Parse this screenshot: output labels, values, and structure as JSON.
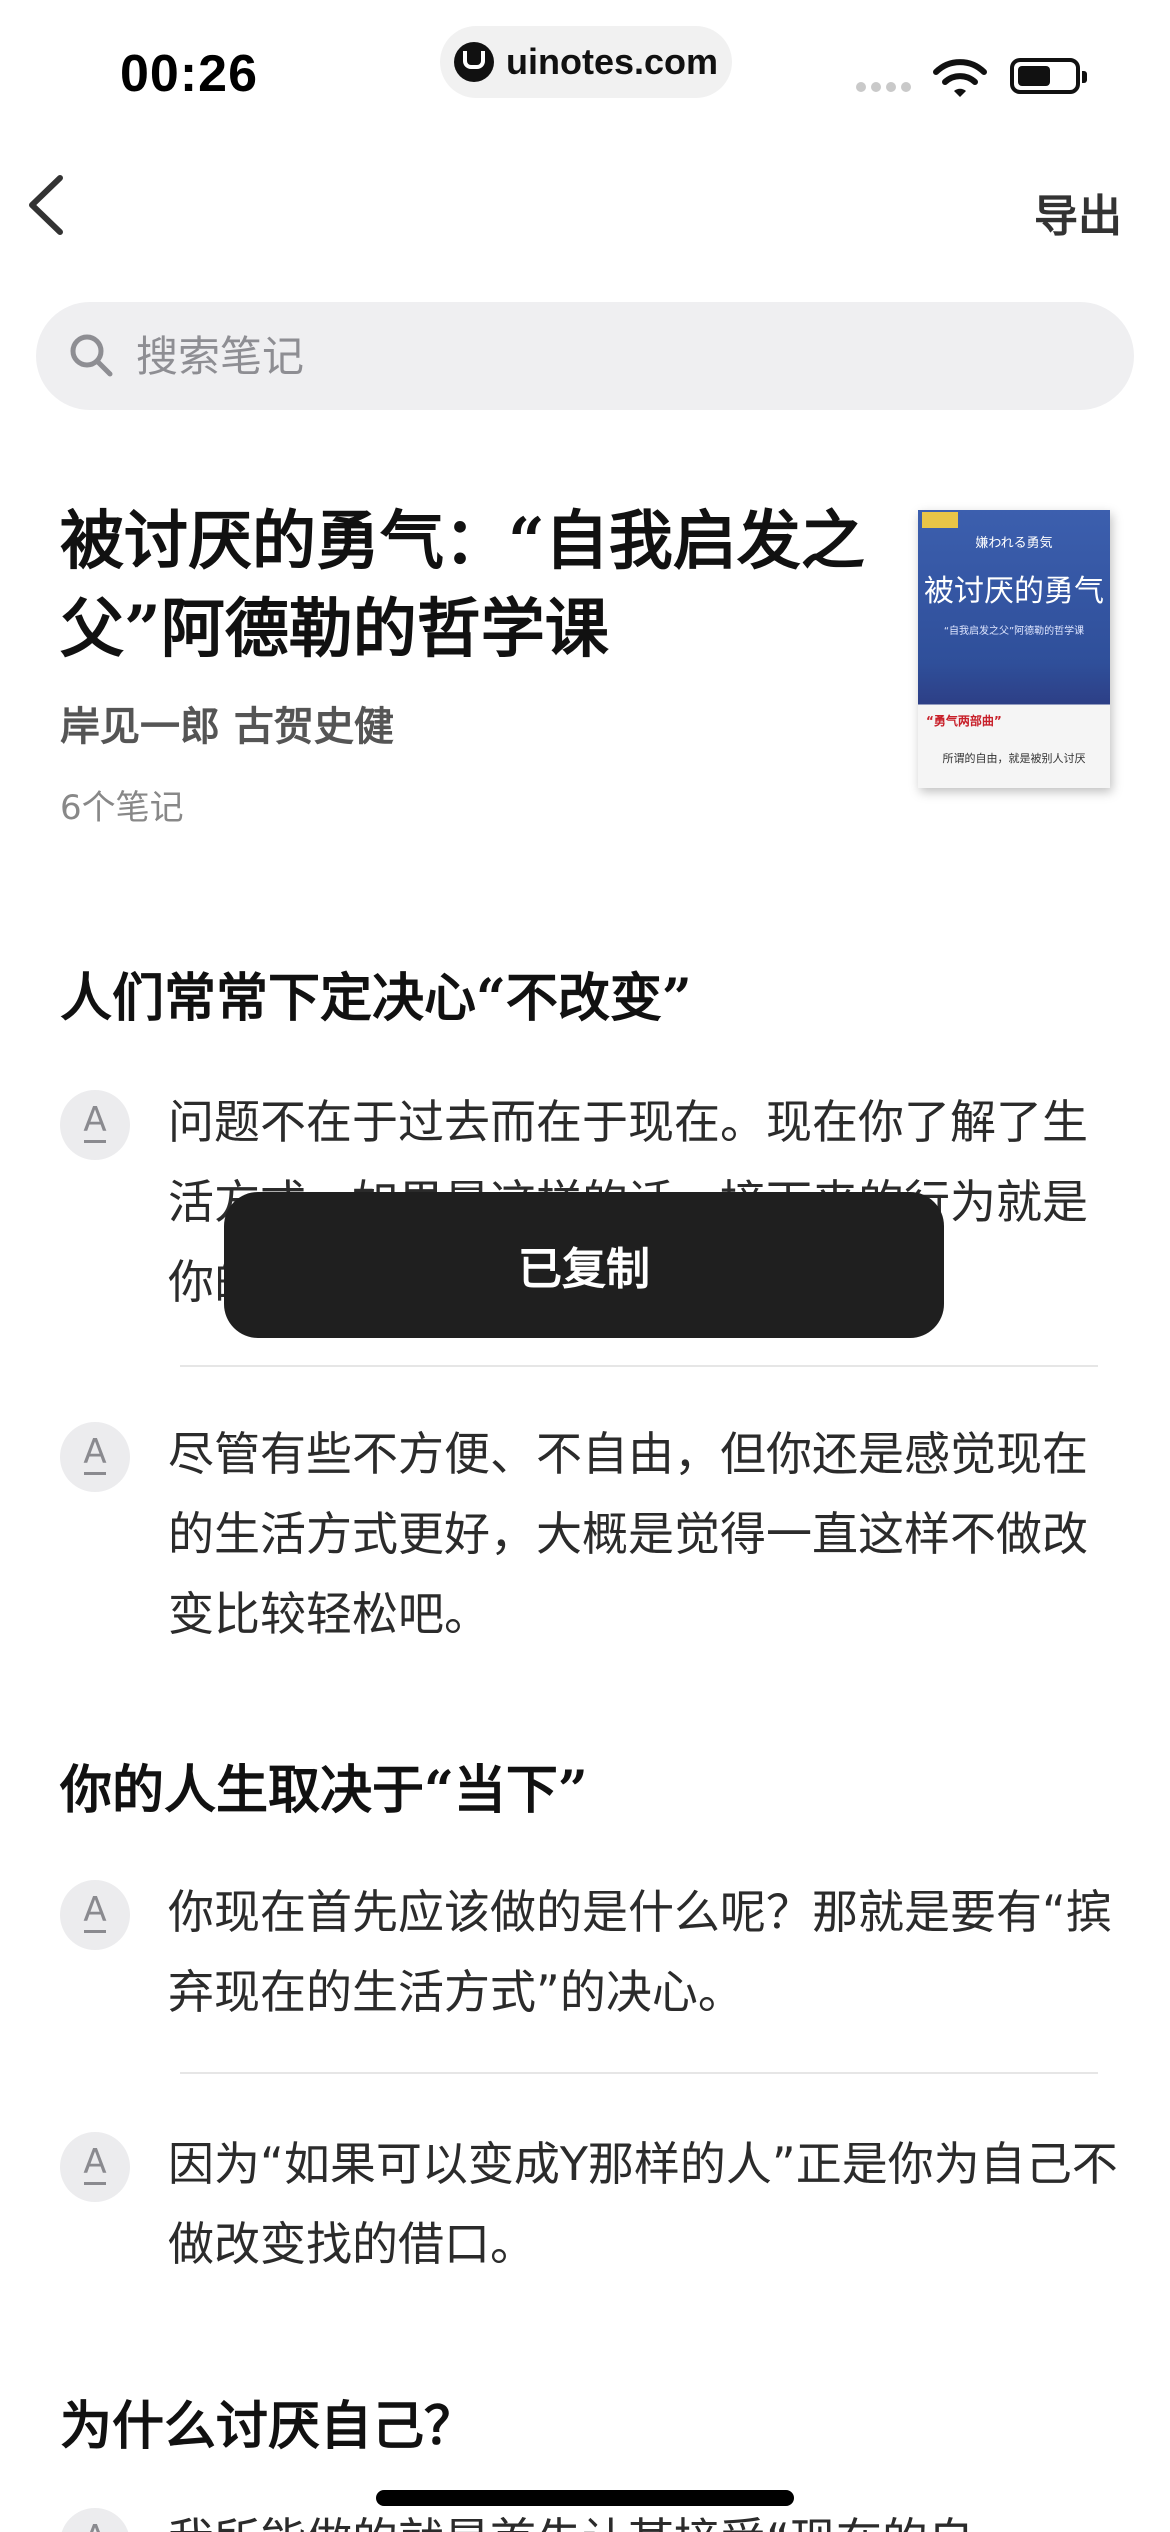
{
  "status_bar": {
    "time": "00:26",
    "url": "uinotes.com"
  },
  "nav": {
    "back_icon": "chevron-left-icon",
    "export_label": "导出"
  },
  "search": {
    "placeholder": "搜索笔记",
    "value": ""
  },
  "book": {
    "title": "被讨厌的勇气：“自我启发之父”阿德勒的哲学课",
    "author": "岸见一郎 古贺史健",
    "note_count": "6个笔记",
    "cover": {
      "top_text": "嫌われる勇気",
      "title": "被讨厌的勇气",
      "subtitle": "“自我启发之父”阿德勒的哲学课",
      "red_text": "“勇气两部曲”",
      "bottom_text": "所谓的自由，就是被别人讨厌"
    }
  },
  "chapters": [
    {
      "title": "人们常常下定决心“不改变”",
      "notes": [
        "问题不在于过去而在于现在。现在你了解了生活方式，如果是这样的话，接下来的行为就是你的责任了。",
        "尽管有些不方便、不自由，但你还是感觉现在的生活方式更好，大概是觉得一直这样不做改变比较轻松吧。"
      ]
    },
    {
      "title": "你的人生取决于“当下”",
      "notes": [
        "你现在首先应该做的是什么呢？那就是要有“摈弃现在的生活方式”的决心。",
        "因为“如果可以变成Y那样的人”正是你为自己不做改变找的借口。"
      ]
    },
    {
      "title": "为什么讨厌自己？",
      "notes": [
        "我所能做的就是首先让某接受“现在的自"
      ]
    }
  ],
  "note_icon_glyph": "A",
  "toast": {
    "message": "已复制"
  }
}
